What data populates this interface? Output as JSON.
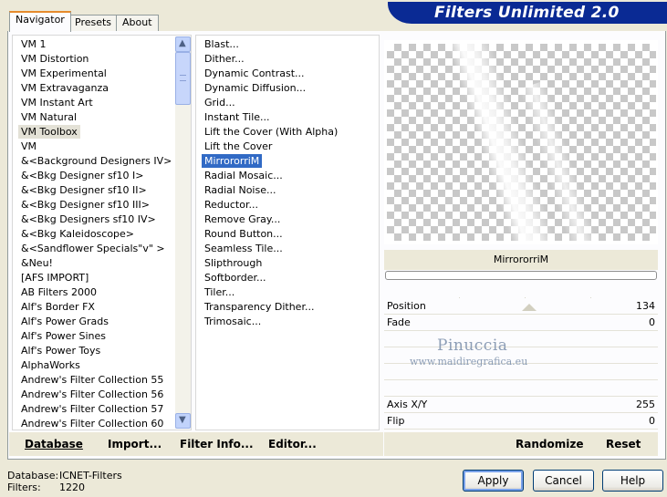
{
  "app": {
    "title": "Filters Unlimited 2.0"
  },
  "tabs": [
    {
      "label": "Navigator",
      "active": true
    },
    {
      "label": "Presets",
      "active": false
    },
    {
      "label": "About",
      "active": false
    }
  ],
  "categories": {
    "items": [
      "VM 1",
      "VM Distortion",
      "VM Experimental",
      "VM Extravaganza",
      "VM Instant Art",
      "VM Natural",
      "VM Toolbox",
      "VM",
      "&<Background Designers IV>",
      "&<Bkg Designer sf10 I>",
      "&<Bkg Designer sf10 II>",
      "&<Bkg Designer sf10 III>",
      "&<Bkg Designers sf10 IV>",
      "&<Bkg Kaleidoscope>",
      "&<Sandflower Specials\"v\" >",
      "&Neu!",
      "[AFS IMPORT]",
      "AB Filters 2000",
      "Alf's Border FX",
      "Alf's Power Grads",
      "Alf's Power Sines",
      "Alf's Power Toys",
      "AlphaWorks",
      "Andrew's Filter Collection 55",
      "Andrew's Filter Collection 56",
      "Andrew's Filter Collection 57",
      "Andrew's Filter Collection 60"
    ],
    "selected": "VM Toolbox"
  },
  "filters": {
    "items": [
      "Blast...",
      "Dither...",
      "Dynamic Contrast...",
      "Dynamic Diffusion...",
      "Grid...",
      "Instant Tile...",
      "Lift the Cover (With Alpha)",
      "Lift the Cover",
      "MirrororriM",
      "Radial Mosaic...",
      "Radial Noise...",
      "Reductor...",
      "Remove Gray...",
      "Round Button...",
      "Seamless Tile...",
      "Slipthrough",
      "Softborder...",
      "Tiler...",
      "Transparency Dither...",
      "Trimosaic..."
    ],
    "selected": "MirrororriM"
  },
  "scrollbar": {
    "up_icon": "arrow-up-icon",
    "down_icon": "arrow-down-icon"
  },
  "preview": {
    "filter_name": "MirrororriM"
  },
  "params": [
    {
      "label": "Position",
      "value": "134"
    },
    {
      "label": "Fade",
      "value": "0"
    },
    {
      "label": "",
      "value": ""
    },
    {
      "label": "",
      "value": ""
    },
    {
      "label": "",
      "value": ""
    },
    {
      "label": "",
      "value": ""
    },
    {
      "label": "Axis X/Y",
      "value": "255"
    },
    {
      "label": "Flip",
      "value": "0"
    }
  ],
  "watermark": {
    "line1": "Pinuccia",
    "line2": "www.maidiregrafica.eu"
  },
  "bottom": {
    "database": "Database",
    "import": "Import...",
    "filter_info": "Filter Info...",
    "editor": "Editor...",
    "randomize": "Randomize",
    "reset": "Reset"
  },
  "status": {
    "database_label": "Database:",
    "database_value": "ICNET-Filters",
    "filters_label": "Filters:",
    "filters_value": "1220"
  },
  "dialog": {
    "apply": "Apply",
    "cancel": "Cancel",
    "help": "Help"
  },
  "colors": {
    "banner": "#0a2a94",
    "selection": "#316ac5",
    "background": "#ece9d8"
  }
}
